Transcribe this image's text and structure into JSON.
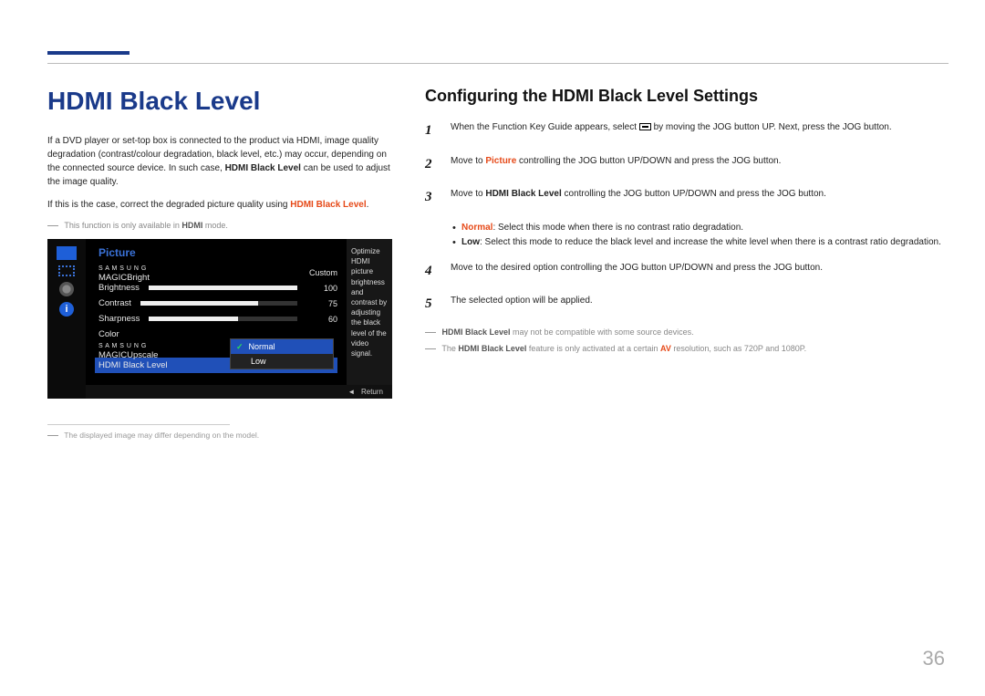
{
  "header": {
    "rule_color": "#1a3a8a"
  },
  "left": {
    "title": "HDMI Black Level",
    "para1_a": "If a DVD player or set-top box is connected to the product via HDMI, image quality degradation (contrast/colour degradation, black level, etc.) may occur, depending on the connected source device. In such case, ",
    "para1_bold": "HDMI Black Level",
    "para1_b": " can be used to adjust the image quality.",
    "para2_a": "If this is the case, correct the degraded picture quality using ",
    "para2_bold": "HDMI Black Level",
    "para2_b": ".",
    "note1_a": "This function is only available in ",
    "note1_bold": "HDMI",
    "note1_b": " mode.",
    "footnote": "The displayed image may differ depending on the model."
  },
  "osd": {
    "title": "Picture",
    "brand_small": "S A M S U N G",
    "magic_bright_label": "MAGICBright",
    "magic_bright_value": "Custom",
    "brightness_label": "Brightness",
    "brightness_value": "100",
    "contrast_label": "Contrast",
    "contrast_value": "75",
    "sharpness_label": "Sharpness",
    "sharpness_value": "60",
    "color_label": "Color",
    "upscale_label": "MAGICUpscale",
    "hbl_label": "HDMI Black Level",
    "side_text": "Optimize HDMI picture brightness and contrast by adjusting the black level of the video signal.",
    "popup_opt1": "Normal",
    "popup_opt2": "Low",
    "foot_arrow": "◄",
    "foot_return": "Return",
    "nav_info_glyph": "i",
    "check_glyph": "✓"
  },
  "right": {
    "title": "Configuring the HDMI Black Level Settings",
    "s1_num": "1",
    "s1_a": "When the Function Key Guide appears, select ",
    "s1_b": " by moving the JOG button UP. Next, press the JOG button.",
    "s2_num": "2",
    "s2_a": "Move to ",
    "s2_bold": "Picture",
    "s2_b": " controlling the JOG button UP/DOWN and press the JOG button.",
    "s3_num": "3",
    "s3_a": "Move to ",
    "s3_bold": "HDMI Black Level",
    "s3_b": " controlling the JOG button UP/DOWN and press the JOG button.",
    "bullet1_bold": "Normal",
    "bullet1_text": ": Select this mode when there is no contrast ratio degradation.",
    "bullet2_bold": "Low",
    "bullet2_text": ": Select this mode to reduce the black level and increase the white level when there is a contrast ratio degradation.",
    "s4_num": "4",
    "s4_text": "Move to the desired option controlling the JOG button UP/DOWN and press the JOG button.",
    "s5_num": "5",
    "s5_text": "The selected option will be applied.",
    "note2_bold": "HDMI Black Level",
    "note2_text": " may not be compatible with some source devices.",
    "note3_a": "The ",
    "note3_bold1": "HDMI Black Level",
    "note3_b": " feature is only activated at a certain ",
    "note3_bold2": "AV",
    "note3_c": " resolution, such as 720P and 1080P."
  },
  "page_number": "36"
}
